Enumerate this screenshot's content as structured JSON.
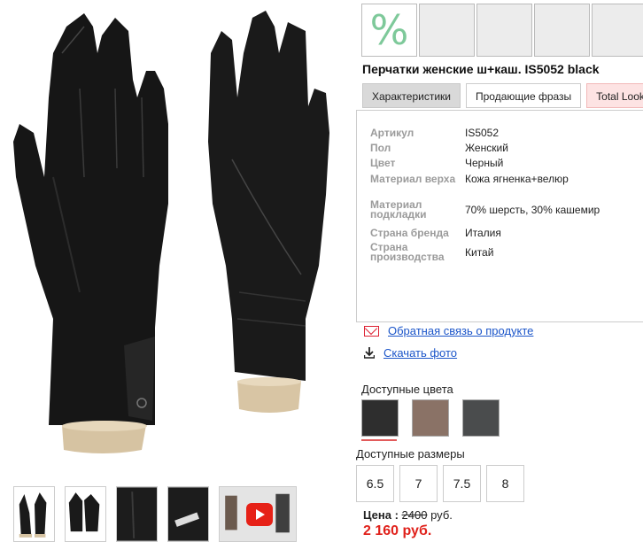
{
  "product": {
    "title": "Перчатки женские ш+каш. IS5052 black"
  },
  "tiles": {
    "percent_symbol": "%"
  },
  "tabs": [
    {
      "label": "Характеристики"
    },
    {
      "label": "Продающие фразы"
    },
    {
      "label": "Total Look"
    }
  ],
  "specs": [
    {
      "key": "Артикул",
      "value": "IS5052"
    },
    {
      "key": "Пол",
      "value": "Женский"
    },
    {
      "key": "Цвет",
      "value": "Черный"
    },
    {
      "key": "Материал верха",
      "value": "Кожа ягненка+велюр"
    },
    {
      "key": "Материал подкладки",
      "value": "70% шерсть, 30% кашемир"
    },
    {
      "key": "Страна бренда",
      "value": "Италия"
    },
    {
      "key": "Страна производства",
      "value": "Китай"
    }
  ],
  "links": {
    "feedback": "Обратная связь о продукте",
    "download": "Скачать фото"
  },
  "colors": {
    "label": "Доступные цвета",
    "swatches": [
      "#2e2e2e",
      "#8a7266",
      "#4a4c4d"
    ]
  },
  "sizes": {
    "label": "Доступные размеры",
    "items": [
      "6.5",
      "7",
      "7.5",
      "8"
    ]
  },
  "price": {
    "label": "Цена :",
    "old": "2400",
    "unit": "руб.",
    "new": "2 160 руб."
  }
}
